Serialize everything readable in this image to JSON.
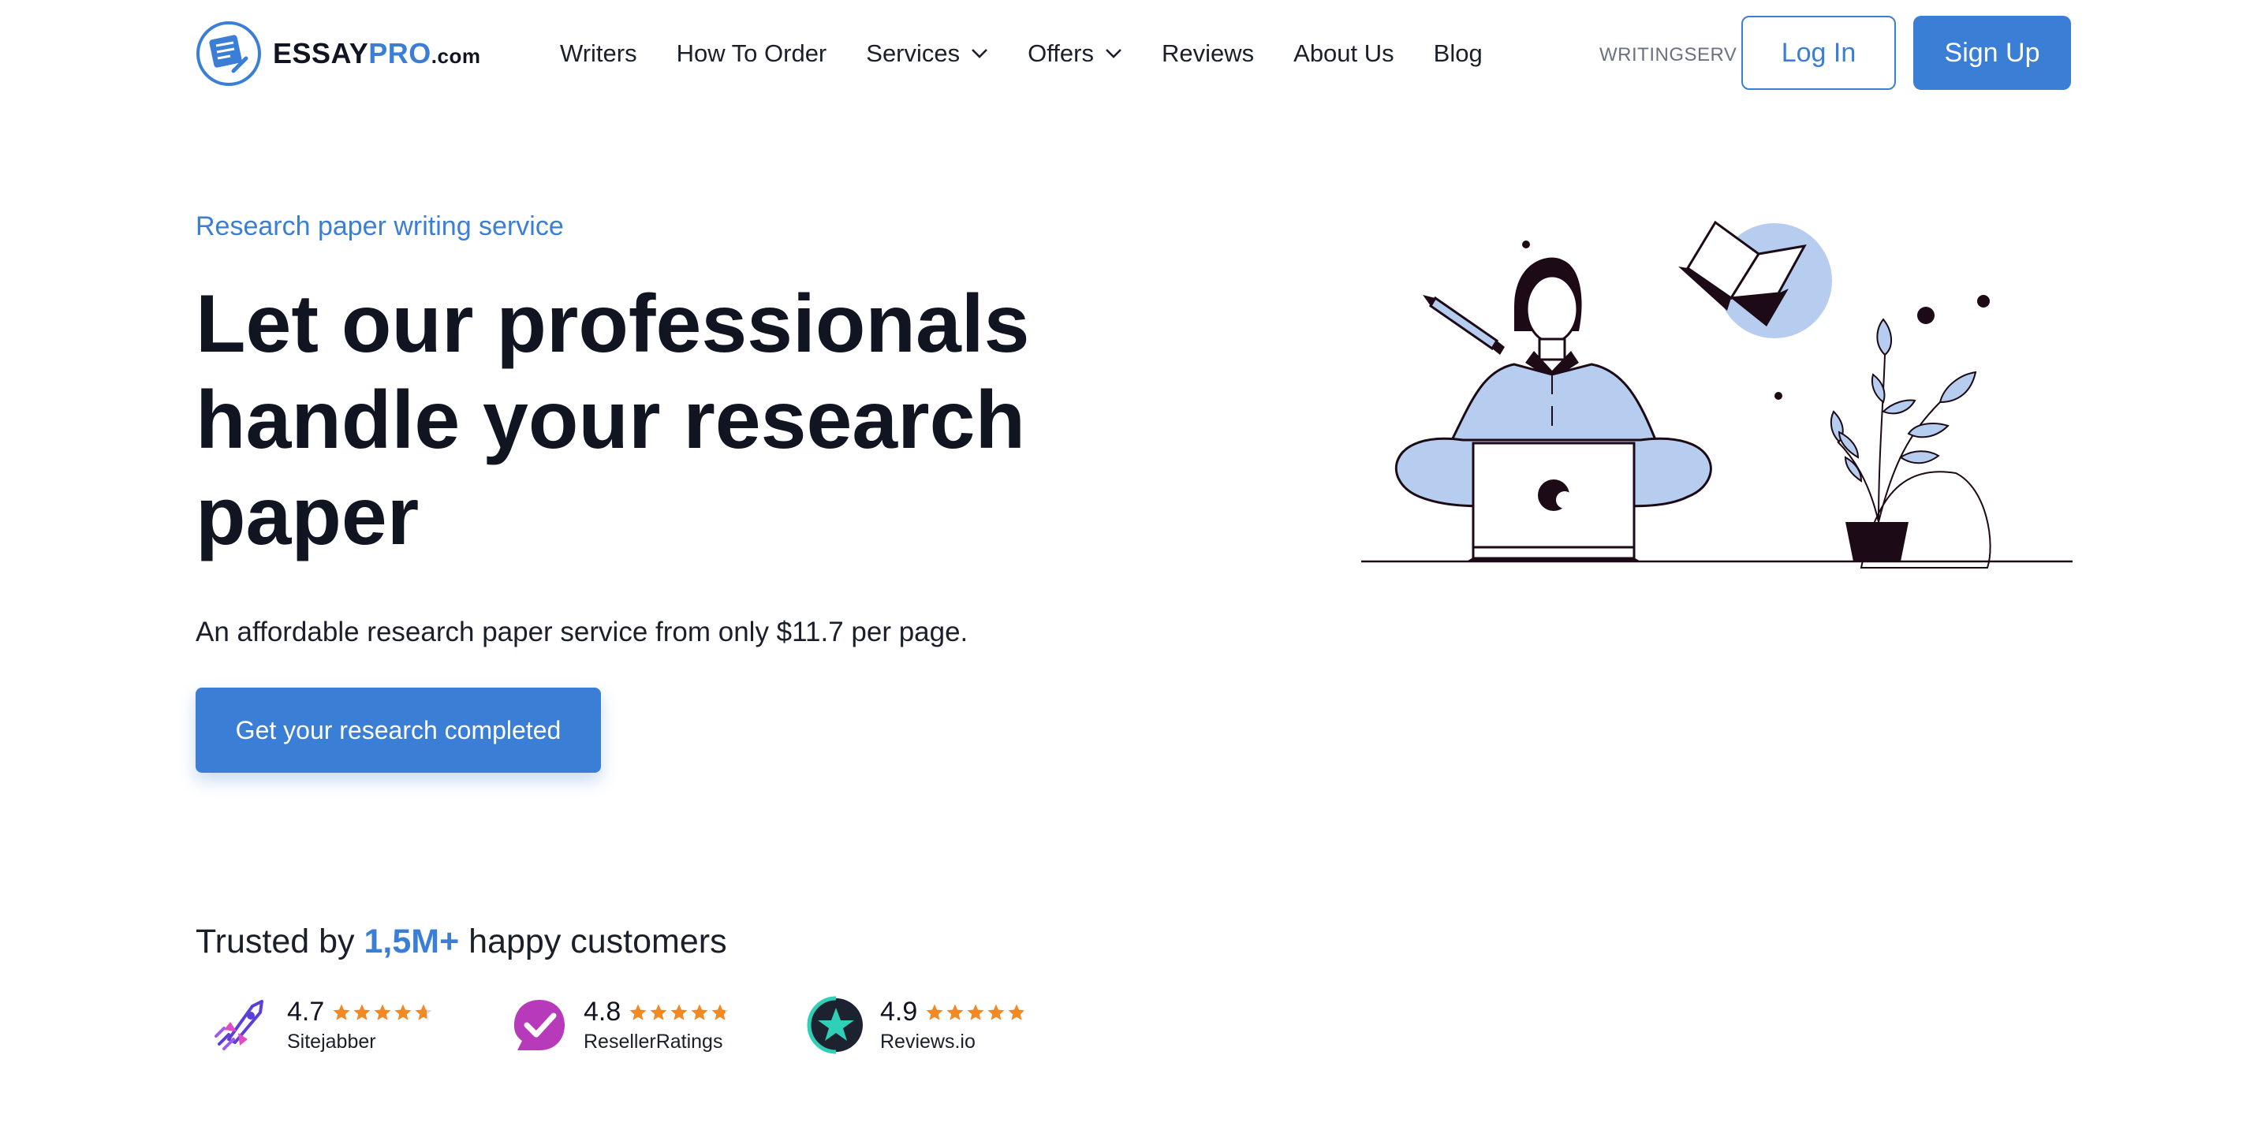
{
  "header": {
    "logo": {
      "brand_main": "ESSAY",
      "brand_accent": "PRO",
      "brand_suffix": ".com"
    },
    "nav": [
      {
        "label": "Writers",
        "dropdown": false
      },
      {
        "label": "How To Order",
        "dropdown": false
      },
      {
        "label": "Services",
        "dropdown": true
      },
      {
        "label": "Offers",
        "dropdown": true
      },
      {
        "label": "Reviews",
        "dropdown": false
      },
      {
        "label": "About Us",
        "dropdown": false
      },
      {
        "label": "Blog",
        "dropdown": false
      }
    ],
    "promo_tag": "WRITINGSERV",
    "login_label": "Log In",
    "signup_label": "Sign Up"
  },
  "hero": {
    "eyebrow": "Research paper writing service",
    "title": "Let our professionals handle your research paper",
    "subtitle": "An affordable research paper service from only $11.7 per page.",
    "cta_label": "Get your research completed"
  },
  "trust": {
    "prefix": "Trusted by ",
    "count": "1,5M+",
    "suffix": " happy customers",
    "ratings": [
      {
        "score": "4.7",
        "name": "Sitejabber",
        "stars": 4.7,
        "icon": "sitejabber-rocket-icon"
      },
      {
        "score": "4.8",
        "name": "ResellerRatings",
        "stars": 4.8,
        "icon": "resellerratings-check-icon"
      },
      {
        "score": "4.9",
        "name": "Reviews.io",
        "stars": 4.9,
        "icon": "reviewsio-star-icon"
      }
    ]
  },
  "colors": {
    "accent": "#3a7fd5",
    "star": "#f08a24",
    "illustration_fill": "#b6cdf0",
    "illustration_dark": "#1c0a17"
  }
}
